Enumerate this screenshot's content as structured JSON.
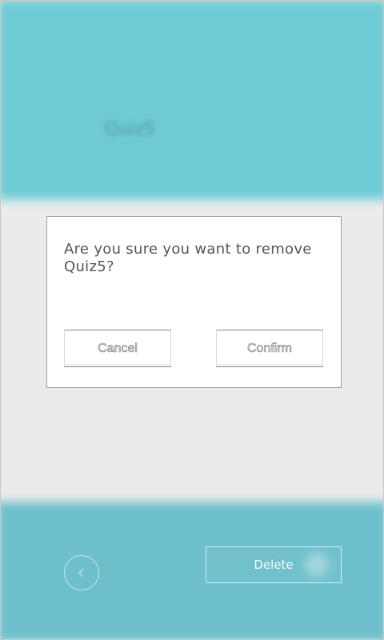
{
  "background": {
    "header_text": "Quiz5",
    "delete_label": "Delete",
    "back_icon": "chevron-left-icon"
  },
  "dialog": {
    "message": "Are you sure you want to remove Quiz5?",
    "cancel_label": "Cancel",
    "confirm_label": "Confirm"
  },
  "colors": {
    "header_bg": "#6ecbd6",
    "footer_bg": "#6cbfcb",
    "page_bg": "#ebebeb",
    "dialog_bg": "#ffffff"
  }
}
